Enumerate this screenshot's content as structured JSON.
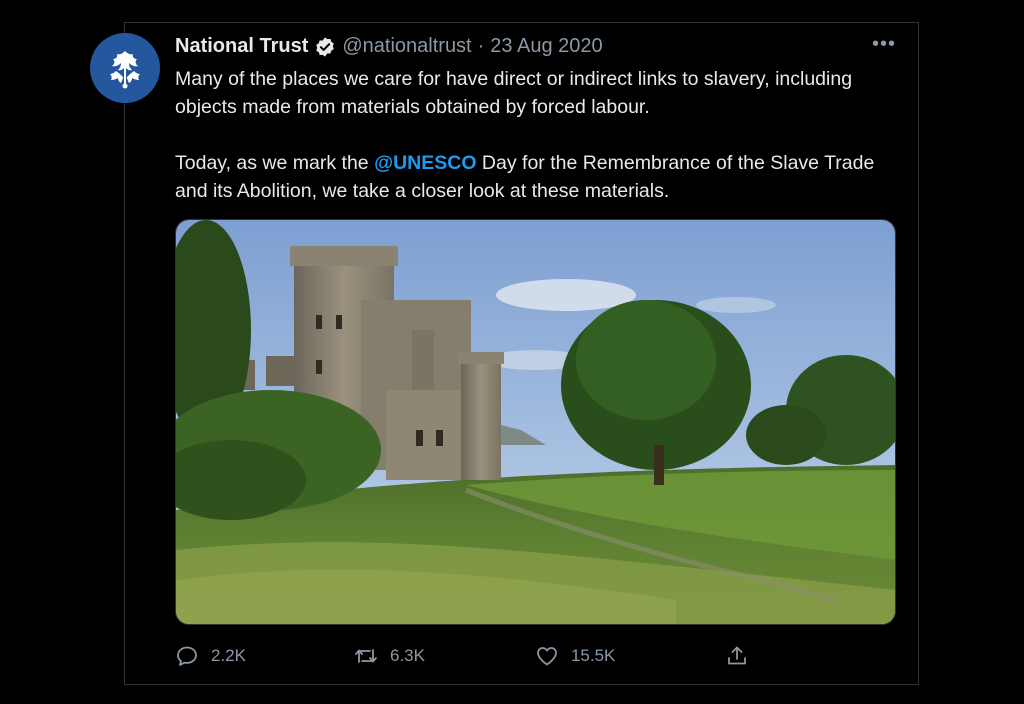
{
  "tweet": {
    "author": {
      "name": "National Trust",
      "handle": "@nationaltrust",
      "separator": "·",
      "date": "23 Aug 2020",
      "avatar_icon": "oak-leaf-icon",
      "avatar_color": "#24579e",
      "verified": true
    },
    "more_label": "•••",
    "text": {
      "paragraph1": "Many of the places we care for have direct or indirect links to slavery, including objects made from materials obtained by forced labour.",
      "paragraph2_before": "Today, as we mark the ",
      "mention": "@UNESCO",
      "paragraph2_after": " Day for the Remembrance of the Slave Trade and its Abolition, we take a closer look at these materials."
    },
    "media": {
      "kind": "photo",
      "subject_icon": "castle-landscape-photo"
    },
    "actions": {
      "replies": "2.2K",
      "retweets": "6.3K",
      "likes": "15.5K",
      "reply_icon": "reply-icon",
      "retweet_icon": "retweet-icon",
      "like_icon": "heart-icon",
      "share_icon": "share-icon"
    },
    "colors": {
      "accent": "#1d9bf0",
      "muted": "#8b98a5",
      "text": "#e7e9ea",
      "background": "#000000"
    }
  }
}
